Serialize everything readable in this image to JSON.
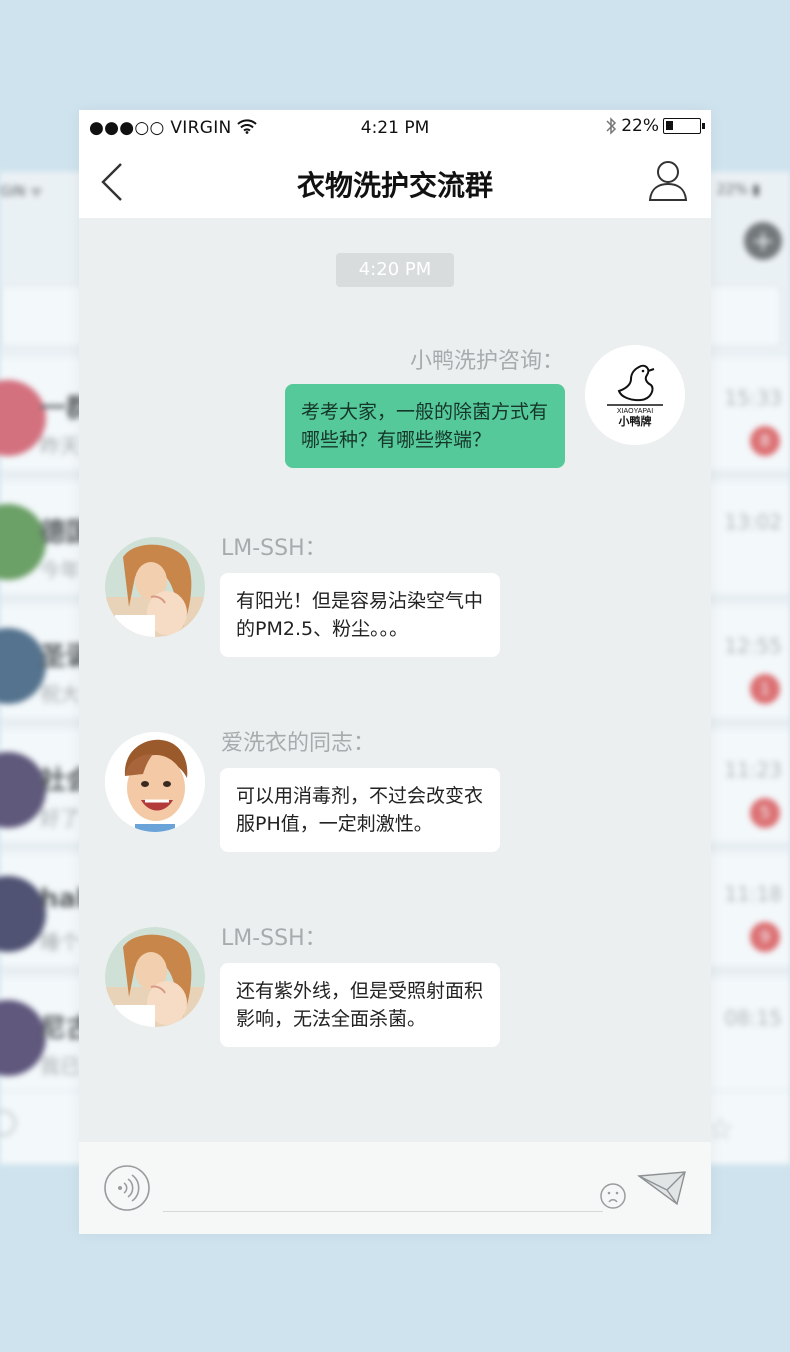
{
  "background_app": {
    "status_left": "GIN ᯤ",
    "status_right": "22% ▮",
    "add_icon": "plus-circle-icon",
    "rows": [
      {
        "name": "一群",
        "sub": "昨天",
        "time": "15:33",
        "badge": "8",
        "avatar_color": "#d64b5a"
      },
      {
        "name": "德国",
        "sub": "今年",
        "time": "13:02",
        "badge": "",
        "avatar_color": "#4a8a3a"
      },
      {
        "name": "圣诞",
        "sub": "祝大",
        "time": "12:55",
        "badge": "1",
        "avatar_color": "#2d4e6e"
      },
      {
        "name": "社会",
        "sub": "好了",
        "time": "11:23",
        "badge": "5",
        "avatar_color": "#3a2b55"
      },
      {
        "name": "hah",
        "sub": "睡个",
        "time": "11:18",
        "badge": "9",
        "avatar_color": "#26234a"
      },
      {
        "name": "尼古",
        "sub": "我已",
        "time": "08:15",
        "badge": "",
        "avatar_color": "#3b2a58"
      }
    ]
  },
  "status_bar": {
    "carrier": "●●●○○ VIRGIN",
    "time": "4:21 PM",
    "battery": "22%"
  },
  "nav": {
    "title": "衣物洗护交流群",
    "back_icon": "chevron-left-icon",
    "profile_icon": "user-icon"
  },
  "chat": {
    "timestamp": "4:20 PM",
    "messages": [
      {
        "sender": "小鸭洗护咨询：",
        "text": "考考大家，一般的除菌方式有哪些种？有哪些弊端？",
        "direction": "out",
        "avatar": "xiaoyapai-logo",
        "logo_small": "XIAOYAPAI",
        "logo_brand": "小鸭牌"
      },
      {
        "sender": "LM-SSH：",
        "text": "有阳光！但是容易沾染空气中的PM2.5、粉尘。。。",
        "direction": "in",
        "avatar": "mother-baby-photo"
      },
      {
        "sender": "爱洗衣的同志：",
        "text": "可以用消毒剂，不过会改变衣服PH值，一定刺激性。",
        "direction": "in",
        "avatar": "toddler-photo"
      },
      {
        "sender": "LM-SSH：",
        "text": "还有紫外线，但是受照射面积影响，无法全面杀菌。",
        "direction": "in",
        "avatar": "mother-baby-photo"
      }
    ]
  },
  "input_bar": {
    "voice_icon": "voice-icon",
    "placeholder": "",
    "emoji_icon": "emoji-icon",
    "send_icon": "send-icon"
  },
  "colors": {
    "accent_bubble": "#56c99a",
    "chat_background": "#eceff0",
    "page_background": "#cfe3ee"
  }
}
